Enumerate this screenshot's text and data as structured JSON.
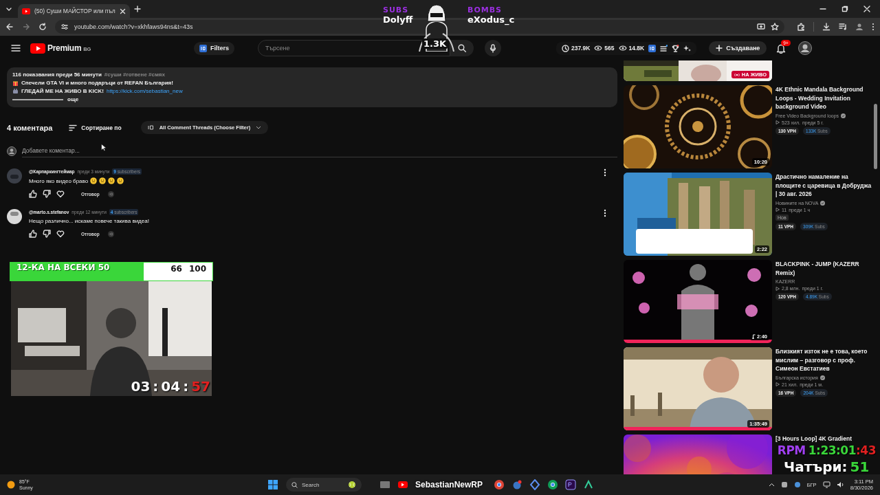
{
  "browser": {
    "tabs": [
      {
        "title": "(50) Суши МАЙСТОР или пъл",
        "selected": true
      }
    ],
    "url": "youtube.com/watch?v=xkhfaws94ns&t=43s"
  },
  "header": {
    "logo": "Premium",
    "region": "BG",
    "filters": "Filters",
    "search_placeholder": "Търсене",
    "stats": [
      "237.9K",
      "565",
      "14.8K"
    ],
    "create": "Създаване",
    "notifications": "9+"
  },
  "description": {
    "meta": "116 показвания  преди 56 минути",
    "tags": "#суши #готвене #смях",
    "lines": [
      {
        "kind": "gift",
        "text": "Спечели GTA VI и много подаръци от REFAN България!"
      },
      {
        "kind": "live",
        "text": "ГЛЕДАЙ МЕ НА ЖИВО В KICK!",
        "link": "https://kick.com/sebastian_new"
      }
    ],
    "more": "още"
  },
  "comments_header": {
    "count": "4 коментара",
    "sort": "Сортиране по",
    "filter": "All Comment Threads (Choose Filter)"
  },
  "add_comment": {
    "placeholder": "Добавете коментар..."
  },
  "comments": [
    {
      "author": "@Карпаркингтеймар",
      "time": "преди 3 минути",
      "subs": "**9** subscribers",
      "text": "Много яко видео браво",
      "emojis": [
        {
          "kind": "smile"
        },
        {
          "kind": "smile"
        },
        {
          "kind": "smile"
        },
        {
          "kind": "smile"
        }
      ],
      "reply": "Отговор"
    },
    {
      "author": "@marto.s.stefanov",
      "time": "преди 12 минути",
      "subs": "**4** subscribers",
      "text": "Нещо различно... искаме повече такива видеа!",
      "reply": "Отговор"
    }
  ],
  "sidebar": [
    {
      "kind": "live",
      "badge": "НА ЖИВО"
    },
    {
      "kind": "mandala",
      "title": "4K Ethnic Mandala Background Loops - Wedding Invitation background Video",
      "channel": "Free Video Background loops",
      "verified": true,
      "views": "523 хил.",
      "age": "преди 5 г.",
      "vph": "130 VPH",
      "subs": "**133K** Subs",
      "duration": "10:20",
      "music": false
    },
    {
      "kind": "news",
      "title": "Драстично намаление на площите с царевица в Добруджа | 30 авг. 2026",
      "channel": "Новините на NOVA",
      "verified": true,
      "views": "11",
      "age": "преди 1 ч",
      "badge": "Нов",
      "vph": "11 VPH",
      "subs": "**309K** Subs",
      "duration": "2:22",
      "music": false
    },
    {
      "kind": "stars",
      "title": "BLACKPINK - JUMP (KAZERR Remix)",
      "channel": "KAZERR",
      "verified": false,
      "views": "2,8 млн.",
      "age": "преди 1 г.",
      "vph": "120 VPH",
      "subs": "**4.89K** Subs",
      "duration": "2:40",
      "music": true
    },
    {
      "kind": "talk",
      "title": "Близкият изток не е това, което мислим – разговор с проф. Симеон Евстатиев",
      "channel": "Българска история",
      "verified": true,
      "views": "21 хил.",
      "age": "преди 1 м.",
      "vph": "16 VPH",
      "subs": "**204K** Subs",
      "duration": "1:35:49",
      "music": false
    },
    {
      "kind": "gradient",
      "title": "[3 Hours Loop] 4K Gradient"
    }
  ],
  "overlay": {
    "subs": {
      "label": "SUBS",
      "name": "Dolyff"
    },
    "bombs": {
      "label": "BOMBS",
      "name": "eXodus_c"
    },
    "count": "1.3K",
    "goal": {
      "label": "12-КА НА ВСЕКИ 50",
      "current": "66",
      "total": "100",
      "level": 0.66
    },
    "timer": {
      "hours": "03",
      "minutes": "04",
      "seconds": "57",
      "sep": ":"
    },
    "rpm": {
      "label": "RPM",
      "value": "1:23:01",
      "tail": ":43"
    },
    "chat": {
      "label": "Чатъри:",
      "value": "51"
    }
  },
  "taskbar": {
    "temp": "85°F",
    "weather": "Sunny",
    "search": "Search",
    "streamer": "SebastianNewRP",
    "lang": "БГР",
    "time": "3:11 PM",
    "date": "8/30/2026"
  }
}
